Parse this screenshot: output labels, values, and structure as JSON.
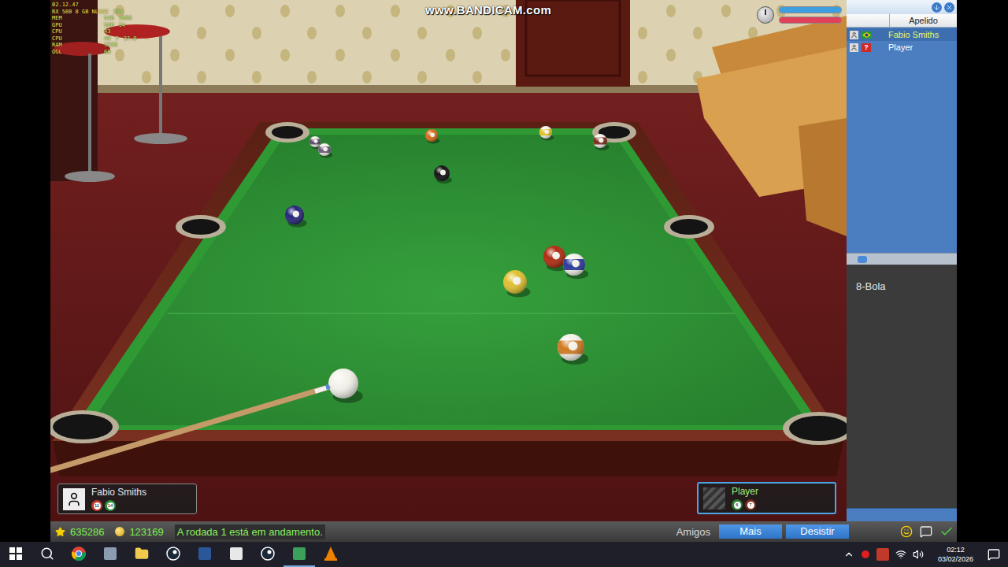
{
  "overlay": {
    "watermark": "www.BANDICAM.com",
    "clock": "02.12.47",
    "stats": [
      {
        "label": "RX 580 8 GB NL55E",
        "values": [
          "39%"
        ]
      },
      {
        "label": "MEM",
        "values": [
          "540",
          "1000"
        ]
      },
      {
        "label": "GPU",
        "values": [
          "580",
          "34"
        ]
      },
      {
        "label": "CPU",
        "values": [
          "43"
        ]
      },
      {
        "label": "CPU",
        "values": [
          "49",
          "7",
          "37.0"
        ]
      },
      {
        "label": "RAM",
        "values": [
          "3320"
        ]
      },
      {
        "label": "OGL",
        "values": [
          "60"
        ]
      }
    ]
  },
  "timer": {
    "bars": [
      {
        "level": 1,
        "color": "#3d9fe0"
      },
      {
        "level": 1,
        "color": "#e0405a"
      }
    ]
  },
  "table": {
    "balls": [
      {
        "kind": "stripe",
        "color": "#5b4a6a"
      },
      {
        "kind": "stripe",
        "color": "#6b5a7a"
      },
      {
        "kind": "solid",
        "color": "#d86a1a"
      },
      {
        "kind": "stripe",
        "color": "#e8c020"
      },
      {
        "kind": "stripe",
        "color": "#7a2a1a"
      },
      {
        "kind": "eight",
        "color": "#111111"
      },
      {
        "kind": "solid",
        "color": "#25257a"
      },
      {
        "kind": "solid",
        "color": "#b02a10"
      },
      {
        "kind": "stripe",
        "color": "#2a3a9a"
      },
      {
        "kind": "solid",
        "color": "#e0c030"
      },
      {
        "kind": "stripe",
        "color": "#d07a20"
      },
      {
        "kind": "cue",
        "color": "#f4f2ea"
      }
    ]
  },
  "players": [
    {
      "name": "Fabio Smiths",
      "active": false,
      "balls": [
        {
          "number": "11",
          "color": "#c0392b"
        },
        {
          "number": "14",
          "color": "#2e8b3a"
        }
      ]
    },
    {
      "name": "Player",
      "active": true,
      "balls": [
        {
          "number": "6",
          "color": "#2e7d32"
        },
        {
          "number": "7",
          "color": "#7b2b1a"
        }
      ]
    }
  ],
  "sidebar": {
    "column": "Apelido",
    "users": [
      {
        "name": "Fabio Smiths",
        "kind": "flag",
        "highlighted": true,
        "badge": ""
      },
      {
        "name": "Player",
        "kind": "unknown",
        "highlighted": false,
        "badge": "?"
      }
    ],
    "room": "8-Bola"
  },
  "status_bar": {
    "stars": "635286",
    "coins": "123169",
    "message": "A rodada 1 está em andamento.",
    "link": "Amigos",
    "buttons": [
      "Mais",
      "Desistir"
    ]
  },
  "taskbar": {
    "time": "02:12",
    "date": "03/02/2026"
  }
}
